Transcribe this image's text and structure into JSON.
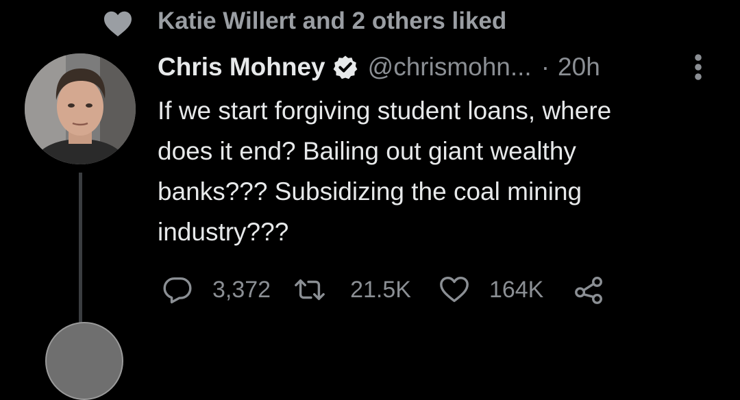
{
  "social_context": {
    "text": "Katie Willert and 2 others liked",
    "icon": "heart-icon"
  },
  "tweet": {
    "author": {
      "display_name": "Chris Mohney",
      "handle": "@chrismohn...",
      "verified": true
    },
    "separator": "·",
    "time": "20h",
    "text": "If we start forgiving student loans, where\ndoes it end? Bailing out giant wealthy\nbanks??? Subsidizing the coal mining\nindustry???",
    "actions": {
      "replies": "3,372",
      "retweets": "21.5K",
      "likes": "164K"
    }
  },
  "colors": {
    "background": "#000000",
    "primary_text": "#e7e9ea",
    "secondary_text": "#8b8f94",
    "thread_line": "#3a3d40"
  }
}
